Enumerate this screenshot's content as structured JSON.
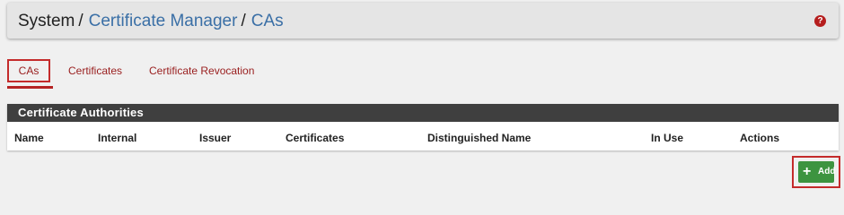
{
  "breadcrumb": {
    "root": "System",
    "separator": "/",
    "section": "Certificate Manager",
    "page": "CAs"
  },
  "help_icon": "question-circle-icon",
  "tabs": [
    {
      "label": "CAs",
      "active": true
    },
    {
      "label": "Certificates",
      "active": false
    },
    {
      "label": "Certificate Revocation",
      "active": false
    }
  ],
  "panel": {
    "title": "Certificate Authorities",
    "columns": [
      "Name",
      "Internal",
      "Issuer",
      "Certificates",
      "Distinguished Name",
      "In Use",
      "Actions"
    ]
  },
  "add_button": {
    "label": "Add",
    "icon": "plus-icon"
  },
  "colors": {
    "link_blue": "#3a6fa6",
    "tab_red": "#9a2020",
    "help_red": "#b51d1d",
    "panel_heading": "#3f3f3f",
    "add_green": "#3d9440"
  }
}
